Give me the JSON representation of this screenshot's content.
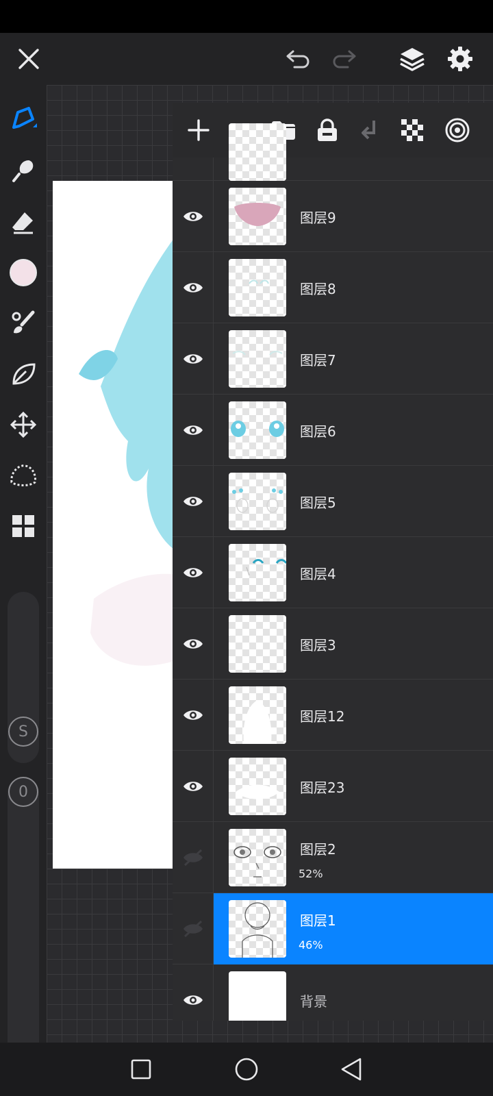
{
  "toolbar": {
    "close_icon": "close-icon",
    "undo_icon": "undo-icon",
    "redo_icon": "redo-icon",
    "layers_icon": "layers-icon",
    "settings_icon": "gear-icon"
  },
  "tools": [
    "pen-tool-icon",
    "smudge-tool-icon",
    "eraser-tool-icon",
    "color-swatch",
    "brush-palette-icon",
    "leaf-shape-icon",
    "move-icon",
    "lasso-selection-icon",
    "gallery-grid-icon"
  ],
  "colors": {
    "accent": "#0a84ff",
    "swatch": "#f3e1e8",
    "hair": "#7fd3e6"
  },
  "sliders": {
    "size_label": "S",
    "opacity_label": "0"
  },
  "layer_panel": {
    "actions": [
      "add-layer-icon",
      "folder-icon",
      "lock-icon",
      "merge-down-icon",
      "checkerboard-icon",
      "blend-mode-icon"
    ],
    "layers": [
      {
        "name": "",
        "visible": true,
        "opacity": ""
      },
      {
        "name": "图层9",
        "visible": true,
        "opacity": ""
      },
      {
        "name": "图层8",
        "visible": true,
        "opacity": ""
      },
      {
        "name": "图层7",
        "visible": true,
        "opacity": ""
      },
      {
        "name": "图层6",
        "visible": true,
        "opacity": ""
      },
      {
        "name": "图层5",
        "visible": true,
        "opacity": ""
      },
      {
        "name": "图层4",
        "visible": true,
        "opacity": ""
      },
      {
        "name": "图层3",
        "visible": true,
        "opacity": ""
      },
      {
        "name": "图层12",
        "visible": true,
        "opacity": ""
      },
      {
        "name": "图层23",
        "visible": true,
        "opacity": ""
      },
      {
        "name": "图层2",
        "visible": false,
        "opacity": "52%"
      },
      {
        "name": "图层1",
        "visible": false,
        "opacity": "46%",
        "selected": true
      },
      {
        "name": "背景",
        "visible": true,
        "opacity": ""
      }
    ]
  },
  "navbar": [
    "recent-apps-icon",
    "home-icon",
    "back-icon"
  ]
}
